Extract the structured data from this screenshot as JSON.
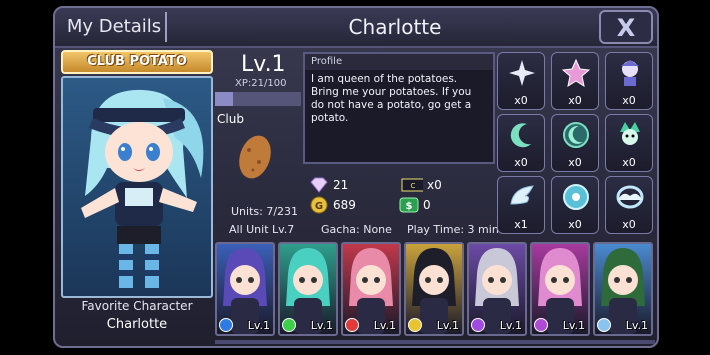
{
  "header": {
    "tab_label": "My Details",
    "title": "Charlotte",
    "close_label": "X"
  },
  "club_banner": "CLUB POTATO",
  "favorite": {
    "label": "Favorite Character",
    "name": "Charlotte"
  },
  "level": {
    "label": "Lv.1",
    "xp_text": "XP:21/100",
    "xp_progress": 0.21
  },
  "club": {
    "label": "Club"
  },
  "profile": {
    "heading": "Profile",
    "text": "I am queen of the potatoes. Bring me your potatoes. If you do not have a potato, go get a potato."
  },
  "stats": {
    "gems": "21",
    "tickets": "x0",
    "gold": "689",
    "cash": "0",
    "units": "Units: 7/231",
    "all_unit_lv": "All Unit Lv.7",
    "gacha": "Gacha: None",
    "play_time": "Play Time: 3 min"
  },
  "items": [
    {
      "icon": "sparkle-icon",
      "count": "x0"
    },
    {
      "icon": "pink-star-icon",
      "count": "x0"
    },
    {
      "icon": "mini-character-icon",
      "count": "x0"
    },
    {
      "icon": "green-crescent-icon",
      "count": "x0"
    },
    {
      "icon": "green-moon-orb-icon",
      "count": "x0"
    },
    {
      "icon": "green-creature-icon",
      "count": "x0"
    },
    {
      "icon": "wing-icon",
      "count": "x1"
    },
    {
      "icon": "disc-icon",
      "count": "x0"
    },
    {
      "icon": "angel-halo-icon",
      "count": "x0"
    }
  ],
  "characters": [
    {
      "name": "purple-hair-fox-girl",
      "level": "Lv.1",
      "bg": "#3b5fb8",
      "orb": "#2f7be6"
    },
    {
      "name": "teal-hair-girl",
      "level": "Lv.1",
      "bg": "#2f9e8c",
      "orb": "#3ccf4a"
    },
    {
      "name": "pink-hair-red-hood-girl",
      "level": "Lv.1",
      "bg": "#c0384a",
      "orb": "#e23a3a"
    },
    {
      "name": "black-hooded-ninja",
      "level": "Lv.1",
      "bg": "#c9a23c",
      "orb": "#e8c430"
    },
    {
      "name": "silver-hair-girl",
      "level": "Lv.1",
      "bg": "#6c4aa6",
      "orb": "#a04ae0"
    },
    {
      "name": "pink-hair-horned-girl",
      "level": "Lv.1",
      "bg": "#a83a9e",
      "orb": "#b04ad6"
    },
    {
      "name": "green-hair-boy",
      "level": "Lv.1",
      "bg": "#4a8ad0",
      "orb": "#8ac4ee"
    }
  ]
}
